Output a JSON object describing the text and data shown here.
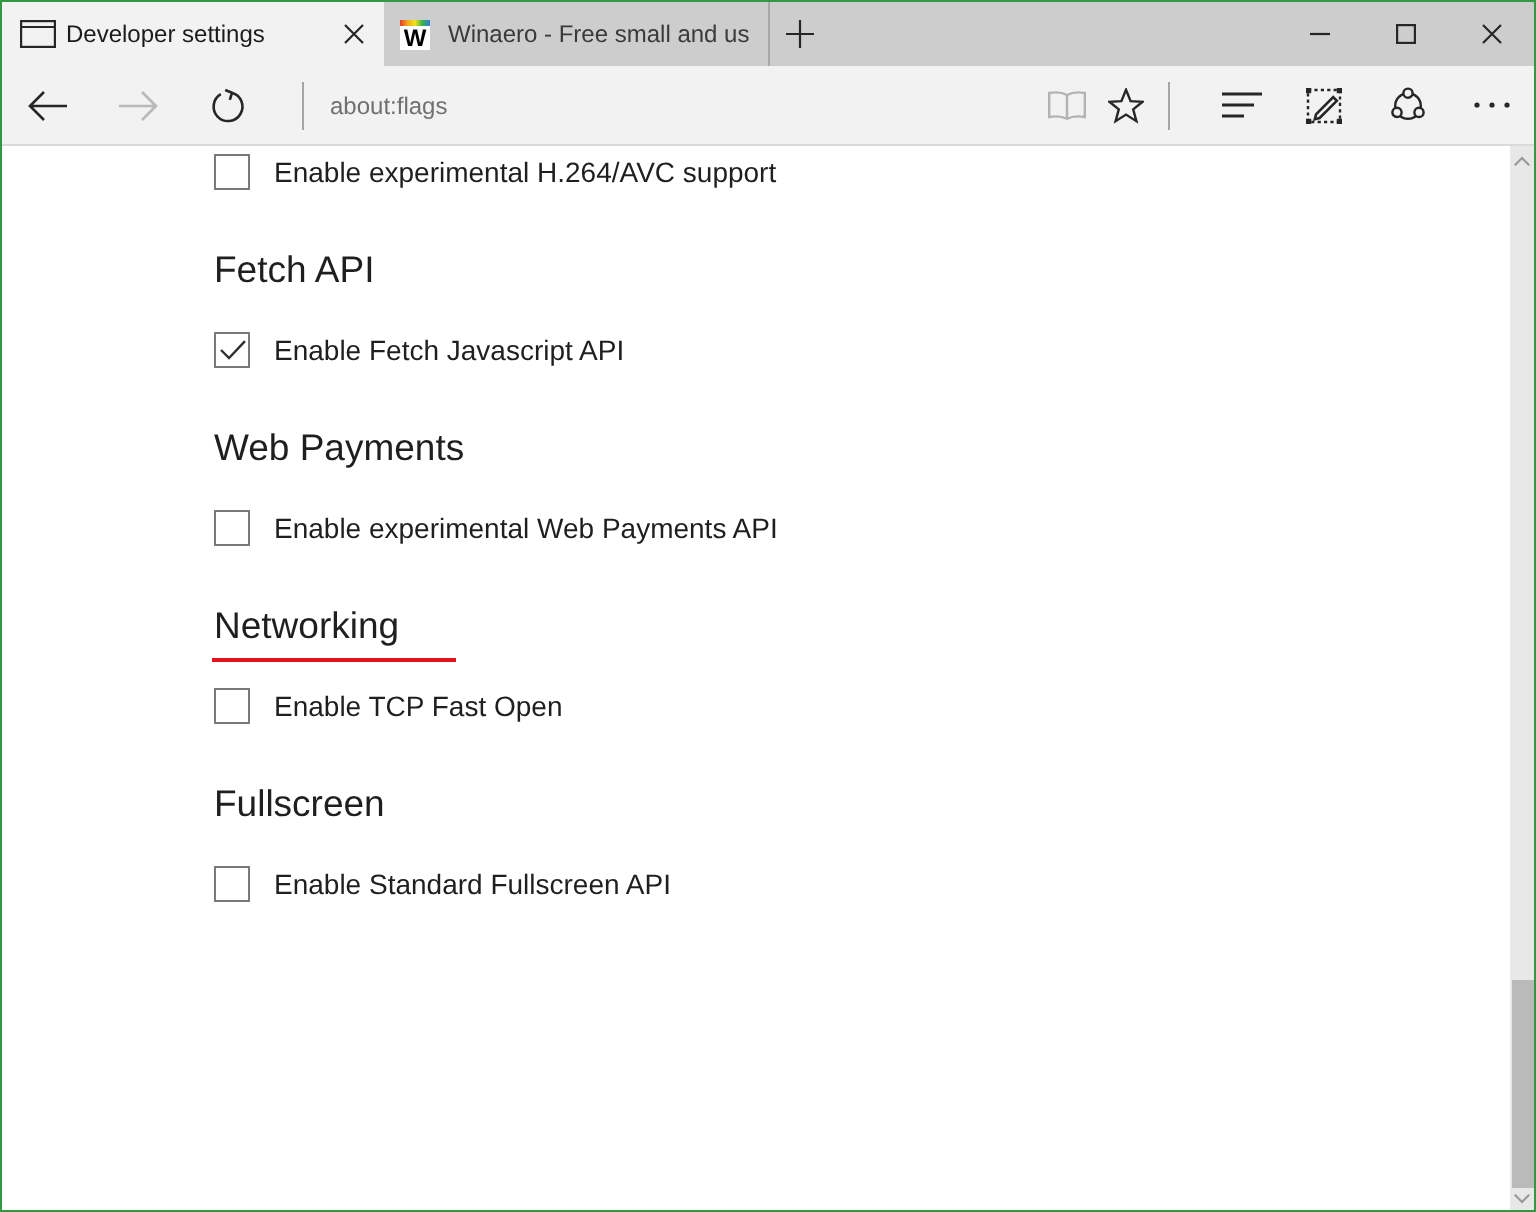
{
  "tabs": [
    {
      "title": "Developer settings",
      "selected": true
    },
    {
      "title": "Winaero - Free small and us",
      "selected": false,
      "favicon_text": "W"
    }
  ],
  "navigation": [
    {
      "kind": "back",
      "disabled": false
    },
    {
      "kind": "forward",
      "disabled": true
    },
    {
      "kind": "refresh",
      "disabled": false
    }
  ],
  "address_bar": {
    "value": "about:flags"
  },
  "toolbar": [
    {
      "kind": "reading-view",
      "disabled": true
    },
    {
      "kind": "favorites",
      "disabled": false
    },
    {
      "kind": "separator"
    },
    {
      "kind": "hub",
      "disabled": false
    },
    {
      "kind": "web-note",
      "disabled": false
    },
    {
      "kind": "share",
      "disabled": false
    },
    {
      "kind": "more",
      "disabled": false
    }
  ],
  "sections": [
    {
      "options": [
        {
          "label": "Enable experimental H.264/AVC support",
          "checked": false
        }
      ]
    },
    {
      "heading": "Fetch API",
      "underlined": false,
      "options": [
        {
          "label": "Enable Fetch Javascript API",
          "checked": true
        }
      ]
    },
    {
      "heading": "Web Payments",
      "underlined": false,
      "options": [
        {
          "label": "Enable experimental Web Payments API",
          "checked": false
        }
      ]
    },
    {
      "heading": "Networking",
      "underlined": true,
      "options": [
        {
          "label": "Enable TCP Fast Open",
          "checked": false
        }
      ]
    },
    {
      "heading": "Fullscreen",
      "underlined": false,
      "options": [
        {
          "label": "Enable Standard Fullscreen API",
          "checked": false
        }
      ]
    }
  ]
}
